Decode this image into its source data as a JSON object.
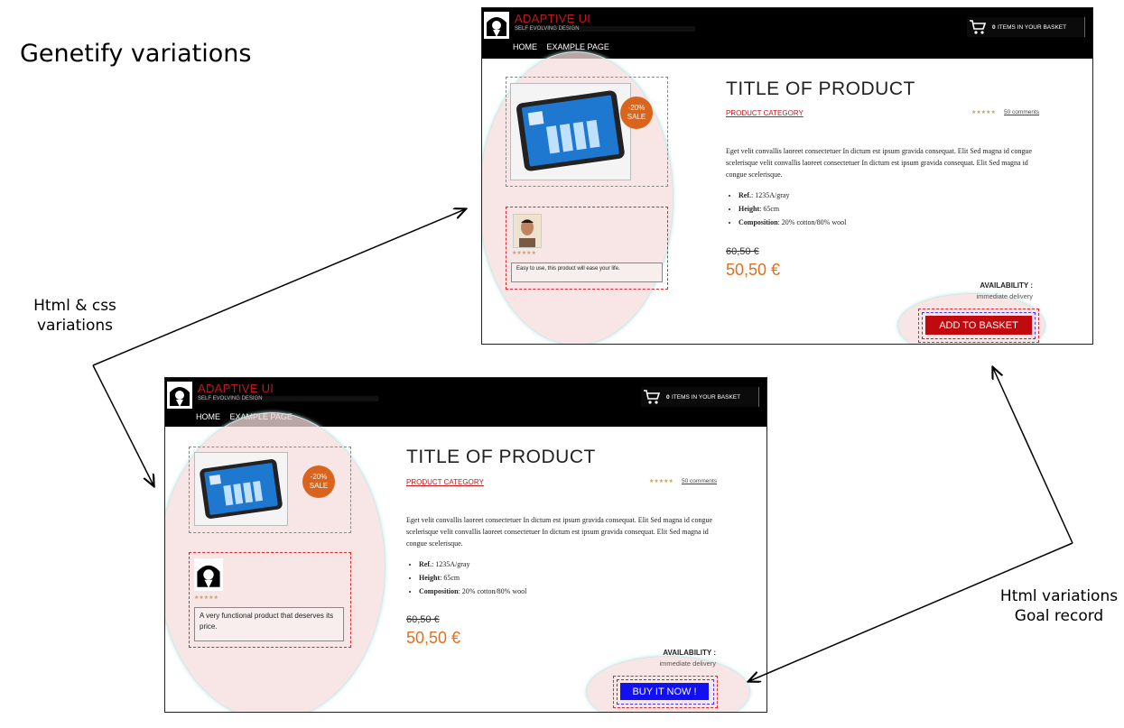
{
  "slide": {
    "title": "Genetify variations",
    "caption_left": [
      "Html & css",
      "variations"
    ],
    "caption_right": [
      "Html variations",
      "Goal record"
    ]
  },
  "colors": {
    "brand_red": "#c0181b",
    "sale_orange": "#d9641e",
    "price_orange": "#e07020",
    "cta_red": "#c00a10",
    "cta_blue": "#1010f0",
    "ellipse_pink": "#f5dede"
  },
  "variant_a": {
    "brand": "ADAPTIVE UI",
    "tagline": "SELF EVOLVING DESIGN",
    "nav": [
      "HOME",
      "EXAMPLE PAGE"
    ],
    "basket_count": "0",
    "basket_label": "ITEMS IN YOUR BASKET",
    "cart_icon": "cart-icon",
    "sale_pct": "-20%",
    "sale_label": "SALE",
    "product_title": "TITLE OF PRODUCT",
    "category": "PRODUCT CATEGORY",
    "stars": "★★★★★",
    "comments": "50 comments",
    "description": "Eget velit convallis laoreet consectetuer In dictum est ipsum gravida consequat. Elit Sed magna id congue scelerisque velit convallis laoreet consectetuer In dictum est ipsum gravida consequat. Elit Sed magna id congue scelerisque.",
    "specs": [
      {
        "label": "Ref.",
        "value": ": 1235A/gray"
      },
      {
        "label": "Height",
        "value": ": 65cm"
      },
      {
        "label": "Composition",
        "value": ": 20% cotton/80% wool"
      }
    ],
    "old_price": "60,50 €",
    "new_price": "50,50 €",
    "availability_label": "AVAILABILITY :",
    "availability_value": "immediate delivery",
    "cta_label": "ADD TO BASKET",
    "review_stars": "★★★★★",
    "review_text": "Easy to use, this product will ease your life.",
    "reviewer_avatar": "person-photo"
  },
  "variant_b": {
    "brand": "ADAPTIVE UI",
    "tagline": "SELF EVOLVING DESIGN",
    "nav": [
      "HOME",
      "EXAMPLE PAGE"
    ],
    "basket_count": "0",
    "basket_label": "ITEMS IN YOUR BASKET",
    "cart_icon": "cart-icon",
    "sale_pct": "-20%",
    "sale_label": "SALE",
    "product_title": "TITLE OF PRODUCT",
    "category": "PRODUCT CATEGORY",
    "stars": "★★★★★",
    "comments": "50 comments",
    "description": "Eget velit convallis laoreet consectetuer In dictum est ipsum gravida consequat. Elit Sed magna id congue scelerisque velit convallis laoreet consectetuer In dictum est ipsum gravida consequat. Elit Sed magna id congue scelerisque.",
    "specs": [
      {
        "label": "Ref.",
        "value": ": 1235A/gray"
      },
      {
        "label": "Height",
        "value": ": 65cm"
      },
      {
        "label": "Composition",
        "value": ": 20% cotton/80% wool"
      }
    ],
    "old_price": "60,50 €",
    "new_price": "50,50 €",
    "availability_label": "AVAILABILITY :",
    "availability_value": "immediate delivery",
    "cta_label": "BUY IT NOW !",
    "review_stars": "★★★★★",
    "review_text": "A very functional product that deserves its price.",
    "reviewer_avatar": "logo-avatar"
  }
}
